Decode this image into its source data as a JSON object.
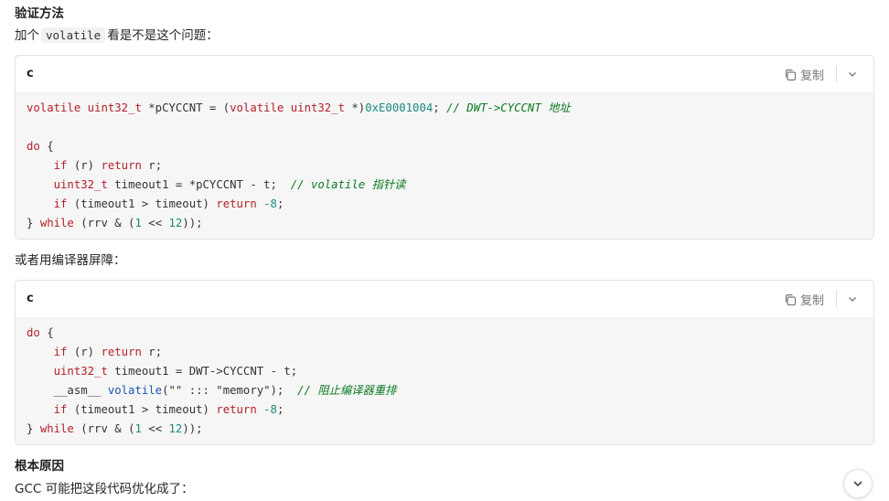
{
  "section1": {
    "heading": "验证方法",
    "intro_before": "加个",
    "intro_code": "volatile",
    "intro_after": "看是不是这个问题："
  },
  "code1": {
    "lang": "c",
    "copy_label": "复制",
    "lines": {
      "l1": {
        "a": "volatile",
        "b": " ",
        "c": "uint32_t",
        "d": " *pCYCCNT = (",
        "e": "volatile",
        "f": " ",
        "g": "uint32_t",
        "h": " *)",
        "i": "0xE0001004",
        "j": "; ",
        "k": "// DWT->CYCCNT 地址"
      },
      "l3": {
        "a": "do",
        "b": " {"
      },
      "l4": {
        "a": "    ",
        "b": "if",
        "c": " (r) ",
        "d": "return",
        "e": " r;"
      },
      "l5": {
        "a": "    ",
        "b": "uint32_t",
        "c": " timeout1 = *pCYCCNT - t;  ",
        "d": "// volatile 指针读"
      },
      "l6": {
        "a": "    ",
        "b": "if",
        "c": " (timeout1 > timeout) ",
        "d": "return",
        "e": " ",
        "f": "-8",
        "g": ";"
      },
      "l7": {
        "a": "} ",
        "b": "while",
        "c": " (rrv & (",
        "d": "1",
        "e": " << ",
        "f": "12",
        "g": "));"
      }
    }
  },
  "section2": {
    "text": "或者用编译器屏障："
  },
  "code2": {
    "lang": "c",
    "copy_label": "复制",
    "lines": {
      "l1": {
        "a": "do",
        "b": " {"
      },
      "l2": {
        "a": "    ",
        "b": "if",
        "c": " (r) ",
        "d": "return",
        "e": " r;"
      },
      "l3": {
        "a": "    ",
        "b": "uint32_t",
        "c": " timeout1 = DWT->CYCCNT - t;"
      },
      "l4": {
        "a": "    __asm__ ",
        "b": "volatile",
        "c": "(\"\" ::: \"memory\");  ",
        "d": "// 阻止编译器重排"
      },
      "l5": {
        "a": "    ",
        "b": "if",
        "c": " (timeout1 > timeout) ",
        "d": "return",
        "e": " ",
        "f": "-8",
        "g": ";"
      },
      "l6": {
        "a": "} ",
        "b": "while",
        "c": " (rrv & (",
        "d": "1",
        "e": " << ",
        "f": "12",
        "g": "));"
      }
    }
  },
  "section3": {
    "heading": "根本原因",
    "text": "GCC 可能把这段代码优化成了："
  },
  "icons": {
    "copy": "copy-icon",
    "collapse": "chevron-down-icon",
    "scroll": "chevron-down-icon"
  }
}
